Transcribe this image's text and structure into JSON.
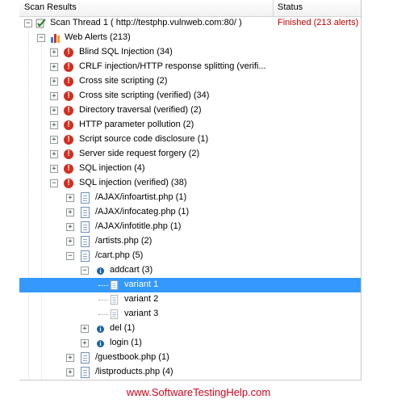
{
  "header": {
    "col_scan_results": "Scan Results",
    "col_status": "Status"
  },
  "tree": {
    "thread": {
      "label": "Scan Thread 1 ( http://testphp.vulnweb.com:80/ )",
      "status": "Finished (213 alerts)"
    },
    "web_alerts": {
      "label": "Web Alerts (213)"
    },
    "alerts": [
      "Blind SQL Injection (34)",
      "CRLF injection/HTTP response splitting (verifi...",
      "Cross site scripting (2)",
      "Cross site scripting (verified) (34)",
      "Directory traversal (verified) (2)",
      "HTTP parameter pollution (2)",
      "Script source code disclosure (1)",
      "Server side request forgery (2)",
      "SQL injection (4)",
      "SQL injection (verified) (38)"
    ],
    "files": [
      "/AJAX/infoartist.php (1)",
      "/AJAX/infocateg.php (1)",
      "/AJAX/infotitle.php (1)",
      "/artists.php (2)",
      "/cart.php (5)"
    ],
    "params": {
      "addcart": "addcart (3)",
      "del": "del (1)",
      "login": "login (1)"
    },
    "variants": [
      "variant 1",
      "variant 2",
      "variant 3"
    ],
    "more_files": [
      "/guestbook.php (1)",
      "/listproducts.php (4)"
    ]
  },
  "selected_item": "variant 1",
  "footer": {
    "watermark": "www.SoftwareTestingHelp.com"
  },
  "colors": {
    "selection": "#3399ff",
    "status": "#c00000",
    "alert_icon": "#d32e1f",
    "watermark": "#d0021b"
  }
}
